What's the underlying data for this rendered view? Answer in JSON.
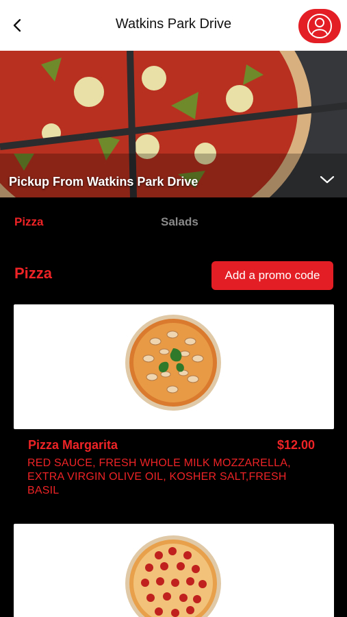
{
  "header": {
    "title": "Watkins Park Drive",
    "back_icon": "chevron-left-icon",
    "profile_icon": "user-icon",
    "accent": "#e31e24"
  },
  "hero": {
    "pickup_label": "Pickup From Watkins Park Drive",
    "dropdown_icon": "chevron-down-icon"
  },
  "tabs": [
    {
      "label": "Pizza",
      "active": true
    },
    {
      "label": "Salads",
      "active": false
    }
  ],
  "section": {
    "title": "Pizza",
    "promo_label": "Add a promo code"
  },
  "menu_items": [
    {
      "name": "Pizza Margarita",
      "price": "$12.00",
      "description": "RED SAUCE, FRESH WHOLE MILK MOZZARELLA, EXTRA VIRGIN OLIVE OIL, KOSHER SALT,FRESH BASIL"
    },
    {
      "name": "",
      "price": "",
      "description": ""
    }
  ]
}
